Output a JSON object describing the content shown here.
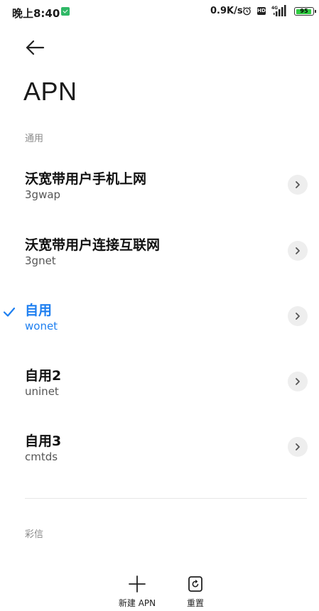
{
  "status_bar": {
    "time": "晚上8:40",
    "net_speed": "0.9K/s",
    "hd_label": "HD",
    "network_type": "4G",
    "battery": "95",
    "battery_level": 95,
    "icons": [
      "app-notification-icon",
      "alarm-icon",
      "hd-icon",
      "signal-icon",
      "battery-icon"
    ]
  },
  "header": {
    "title": "APN"
  },
  "sections": {
    "general": "通用",
    "mms": "彩信"
  },
  "apn_list": [
    {
      "name": "沃宽带用户手机上网",
      "apn": "3gwap",
      "selected": false
    },
    {
      "name": "沃宽带用户连接互联网",
      "apn": "3gnet",
      "selected": false
    },
    {
      "name": "自用",
      "apn": "wonet",
      "selected": true
    },
    {
      "name": "自用2",
      "apn": "uninet",
      "selected": false
    },
    {
      "name": "自用3",
      "apn": "cmtds",
      "selected": false
    }
  ],
  "actions": {
    "new_apn": "新建 APN",
    "reset": "重置"
  },
  "colors": {
    "accent": "#1e7ff0",
    "battery": "#2ecc40",
    "notification": "#2fb866"
  }
}
